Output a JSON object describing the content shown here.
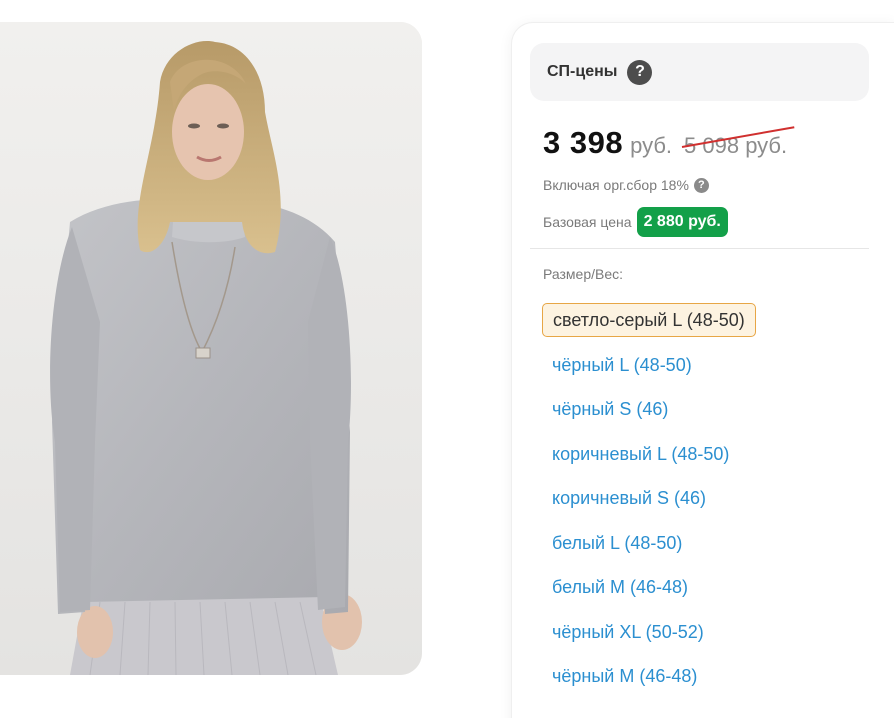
{
  "product": {
    "image_alt": "Женщина в светло-сером свитере"
  },
  "pricing": {
    "header_title": "СП-цены",
    "help_icon": "question-circle-icon",
    "price": "3 398",
    "currency": "руб.",
    "old_price": "5 098 руб.",
    "fee_text": "Включая орг.сбор 18%",
    "base_label": "Базовая цена",
    "base_price": "2 880 руб.",
    "colors": {
      "base_badge": "#13a049",
      "strike": "#d0302f",
      "link": "#2b8fd0",
      "selected_bg": "#fdf3e1",
      "selected_border": "#e7a646"
    }
  },
  "sizes": {
    "label": "Размер/Вес:",
    "selected_index": 0,
    "options": [
      "светло-серый L (48-50)",
      "чёрный L (48-50)",
      "чёрный S (46)",
      "коричневый L (48-50)",
      "коричневый S (46)",
      "белый L (48-50)",
      "белый M (46-48)",
      "чёрный XL (50-52)",
      "чёрный M (46-48)"
    ]
  }
}
